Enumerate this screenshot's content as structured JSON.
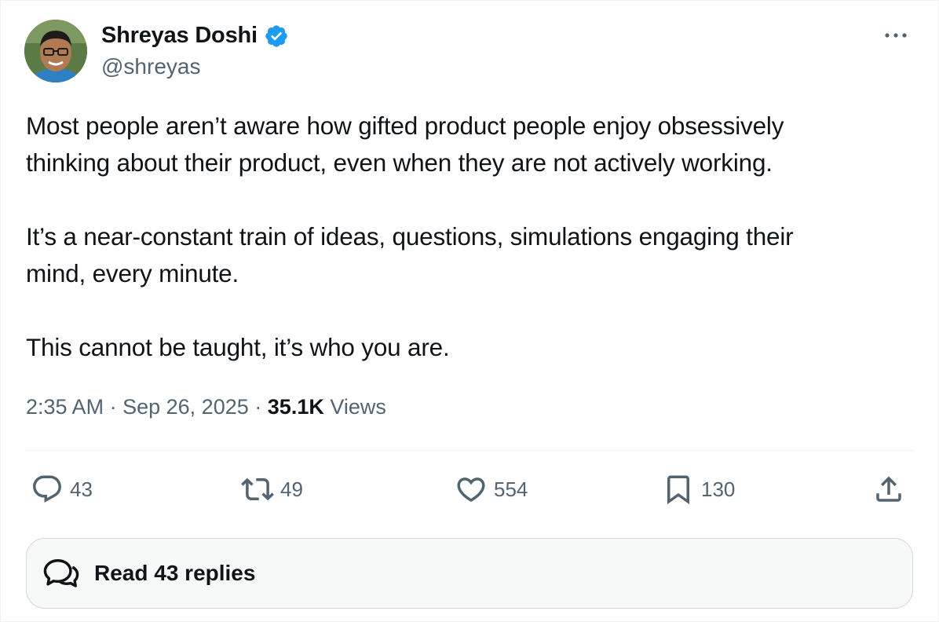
{
  "author": {
    "name": "Shreyas Doshi",
    "handle": "@shreyas",
    "avatar_icon": "avatar",
    "verified_icon": "verified-badge-icon",
    "verified_color": "#1d9bf0"
  },
  "more_icon": "more-options-icon",
  "tweet": {
    "paragraphs": [
      [
        "Most people aren’t aware how gifted product people enjoy obsessively",
        "thinking about their product, even when they are not actively working."
      ],
      [
        "It’s a near-constant train of ideas, questions, simulations engaging their",
        "mind, every minute."
      ],
      [
        "This cannot be taught, it’s who you are."
      ]
    ]
  },
  "meta": {
    "time": "2:35 AM",
    "separator": "·",
    "date": "Sep 26, 2025",
    "views_count": "35.1K",
    "views_label": "Views"
  },
  "actions": {
    "reply": {
      "icon": "reply-icon",
      "count": "43"
    },
    "retweet": {
      "icon": "retweet-icon",
      "count": "49"
    },
    "like": {
      "icon": "heart-icon",
      "count": "554"
    },
    "bookmark": {
      "icon": "bookmark-icon",
      "count": "130"
    },
    "share": {
      "icon": "share-icon"
    }
  },
  "read_replies": {
    "icon": "chat-bubbles-icon",
    "label": "Read 43 replies"
  },
  "colors": {
    "text": "#0f1419",
    "secondary": "#536471",
    "border": "#cfd9de",
    "divider": "#eff3f4",
    "button_bg": "#f7f9f9"
  }
}
